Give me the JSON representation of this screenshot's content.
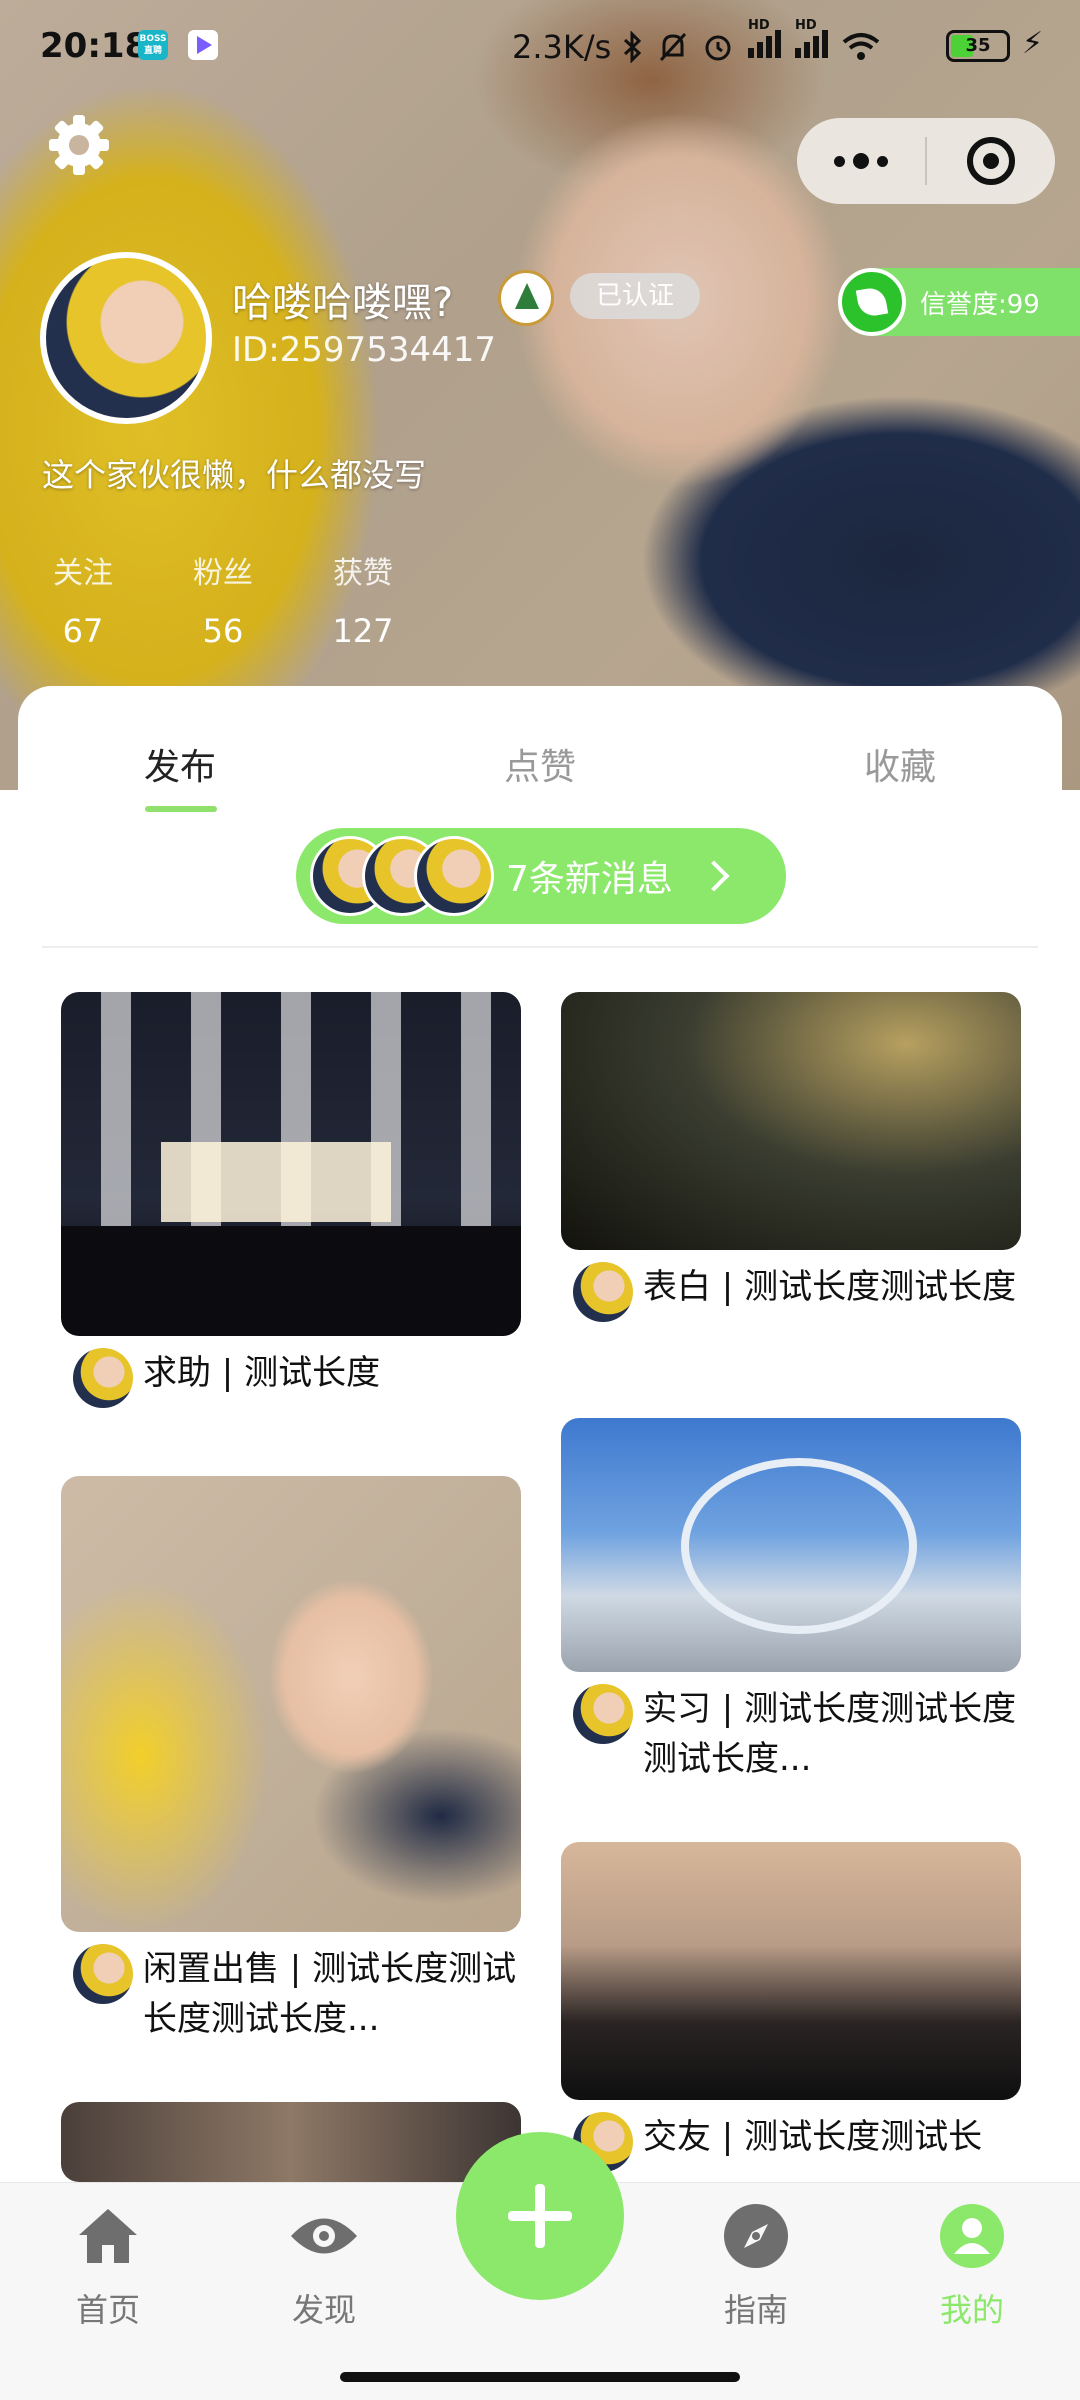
{
  "status_bar": {
    "time": "20:18",
    "app_badge_1": "BOSS 直聘",
    "network_speed": "2.3K/s",
    "signal_1_label": "HD",
    "signal_2_label": "HD",
    "battery": "35"
  },
  "profile": {
    "username": "哈喽哈喽嘿?",
    "verified_label": "已认证",
    "user_id": "ID:2597534417",
    "credit_label": "信誉度:99",
    "bio": "这个家伙很懒，什么都没写",
    "stats": [
      {
        "label": "关注",
        "value": "67"
      },
      {
        "label": "粉丝",
        "value": "56"
      },
      {
        "label": "获赞",
        "value": "127"
      }
    ]
  },
  "tabs": [
    {
      "label": "发布",
      "active": true
    },
    {
      "label": "点赞",
      "active": false
    },
    {
      "label": "收藏",
      "active": false
    }
  ],
  "notification": {
    "text": "7条新消息"
  },
  "posts_left": [
    {
      "title": "求助 | 测试长度",
      "image": "night-building"
    },
    {
      "title": "闲置出售 | 测试长度测试长度测试长度...",
      "image": "girl-photo"
    },
    {
      "title": "",
      "image": "blurred"
    }
  ],
  "posts_right": [
    {
      "title": "表白 | 测试长度测试长度",
      "image": "blurred-dark"
    },
    {
      "title": "实习 | 测试长度测试长度测试长度...",
      "image": "campus-sculpture"
    },
    {
      "title": "交友 | 测试长度测试长",
      "image": "blurred-skin"
    }
  ],
  "bottom_nav": [
    {
      "label": "首页",
      "icon": "home-icon"
    },
    {
      "label": "发现",
      "icon": "eye-icon"
    },
    {
      "label": "指南",
      "icon": "compass-icon"
    },
    {
      "label": "我的",
      "icon": "user-icon",
      "active": true
    }
  ],
  "colors": {
    "accent": "#8be86a",
    "credit_green": "#2cc22c",
    "tab_inactive": "#999999"
  }
}
